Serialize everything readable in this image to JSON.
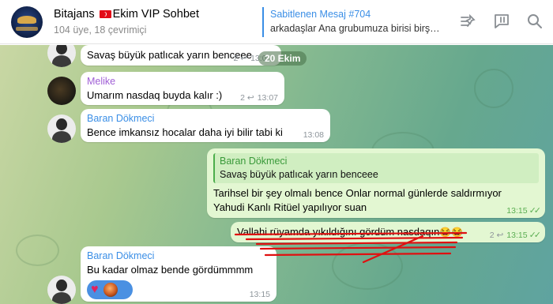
{
  "header": {
    "title_prefix": "Bitajans",
    "title_suffix": "Ekim VIP Sohbet",
    "subtitle": "104 üye, 18 çevrimiçi",
    "pinned_title": "Sabitlenen Mesaj #704",
    "pinned_text": "arkadaşlar Ana grubumuza birisi birş…",
    "icons": [
      "pin-list-icon",
      "message-icon",
      "search-icon"
    ]
  },
  "date_pill": "20 Ekim",
  "messages": [
    {
      "text": "Savaş büyük patlıcak yarın benceee",
      "replies": "2",
      "time": "13:0…"
    },
    {
      "sender": "Melike",
      "sender_color": "#a05fd6",
      "text": "Umarım nasdaq buyda kalır  :)",
      "replies": "2",
      "time": "13:07"
    },
    {
      "sender": "Baran Dökmeci",
      "sender_color": "#3a8ee6",
      "text": "Bence imkansız hocalar daha iyi bilir tabi ki",
      "time": "13:08"
    },
    {
      "quote_name": "Baran Dökmeci",
      "quote_text": "Savaş büyük patlıcak yarın benceee",
      "line1": "Tarihsel bir şey olmalı bence Onlar normal günlerde saldırmıyor",
      "line2": "Yahudi Kanlı Ritüel yapılıyor suan",
      "time": "13:15"
    },
    {
      "text": "Vallahi rüyamda yıkıldığını gördüm nasdaqın",
      "emoji": "😂😂",
      "replies": "2",
      "time": "13:15"
    },
    {
      "sender": "Baran Dökmeci",
      "sender_color": "#3a8ee6",
      "text": "Bu kadar olmaz bende gördümmmm",
      "time": "13:15"
    }
  ],
  "colors": {
    "accent": "#3a8ee6",
    "outgoing_bubble": "#e3f7d2",
    "annotation": "#e01010"
  }
}
